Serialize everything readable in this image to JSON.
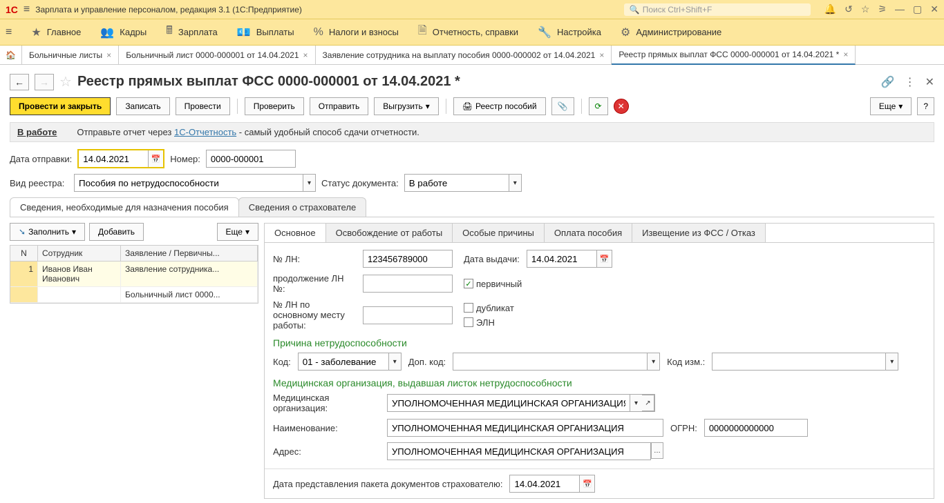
{
  "topbar": {
    "app_title": "Зарплата и управление персоналом, редакция 3.1  (1С:Предприятие)",
    "search_placeholder": "Поиск Ctrl+Shift+F"
  },
  "sections": [
    "Главное",
    "Кадры",
    "Зарплата",
    "Выплаты",
    "Налоги и взносы",
    "Отчетность, справки",
    "Настройка",
    "Администрирование"
  ],
  "tabs": [
    {
      "label": "Больничные листы"
    },
    {
      "label": "Больничный лист 0000-000001 от 14.04.2021"
    },
    {
      "label": "Заявление сотрудника на выплату пособия 0000-000002 от 14.04.2021"
    },
    {
      "label": "Реестр прямых выплат ФСС 0000-000001 от 14.04.2021 *",
      "active": true
    }
  ],
  "page_title": "Реестр прямых выплат ФСС 0000-000001 от 14.04.2021 *",
  "toolbar": {
    "main": "Провести и закрыть",
    "save": "Записать",
    "post": "Провести",
    "check": "Проверить",
    "send": "Отправить",
    "export": "Выгрузить",
    "print": "Реестр пособий",
    "more": "Еще"
  },
  "status": {
    "label": "В работе",
    "prefix": "Отправьте отчет через ",
    "link": "1С-Отчетность",
    "suffix": " - самый удобный способ сдачи отчетности."
  },
  "fields": {
    "send_date_label": "Дата отправки:",
    "send_date": "14.04.2021",
    "number_label": "Номер:",
    "number": "0000-000001",
    "reg_type_label": "Вид реестра:",
    "reg_type": "Пособия по нетрудоспособности",
    "doc_status_label": "Статус документа:",
    "doc_status": "В работе"
  },
  "sub_tabs": [
    "Сведения, необходимые для назначения пособия",
    "Сведения о страхователе"
  ],
  "left": {
    "fill": "Заполнить",
    "add": "Добавить",
    "more": "Еще",
    "cols": {
      "n": "N",
      "emp": "Сотрудник",
      "doc": "Заявление / Первичны..."
    },
    "rows": [
      {
        "n": "1",
        "emp": "Иванов Иван Иванович",
        "doc": "Заявление сотрудника..."
      },
      {
        "n": "",
        "emp": "",
        "doc": "Больничный лист 0000..."
      }
    ]
  },
  "inner_tabs": [
    "Основное",
    "Освобождение от работы",
    "Особые причины",
    "Оплата пособия",
    "Извещение из ФСС / Отказ"
  ],
  "main": {
    "ln_label": "№ ЛН:",
    "ln": "123456789000",
    "issue_label": "Дата выдачи:",
    "issue": "14.04.2021",
    "cont_label": "продолжение ЛН №:",
    "main_ln_label": "№ ЛН по основному месту работы:",
    "primary": "первичный",
    "duplicate": "дубликат",
    "eln": "ЭЛН",
    "reason_head": "Причина нетрудоспособности",
    "code_label": "Код:",
    "code": "01 - заболевание",
    "add_code_label": "Доп. код:",
    "change_code_label": "Код изм.:",
    "med_head": "Медицинская организация, выдавшая листок нетрудоспособности",
    "med_org_label": "Медицинская организация:",
    "med_org": "УПОЛНОМОЧЕННАЯ МЕДИЦИНСКАЯ ОРГАНИЗАЦИЯ",
    "name_label": "Наименование:",
    "name": "УПОЛНОМОЧЕННАЯ МЕДИЦИНСКАЯ ОРГАНИЗАЦИЯ",
    "ogrn_label": "ОГРН:",
    "ogrn": "0000000000000",
    "addr_label": "Адрес:",
    "addr": "УПОЛНОМОЧЕННАЯ МЕДИЦИНСКАЯ ОРГАНИЗАЦИЯ",
    "submit_label": "Дата представления пакета документов страхователю:",
    "submit_date": "14.04.2021"
  }
}
